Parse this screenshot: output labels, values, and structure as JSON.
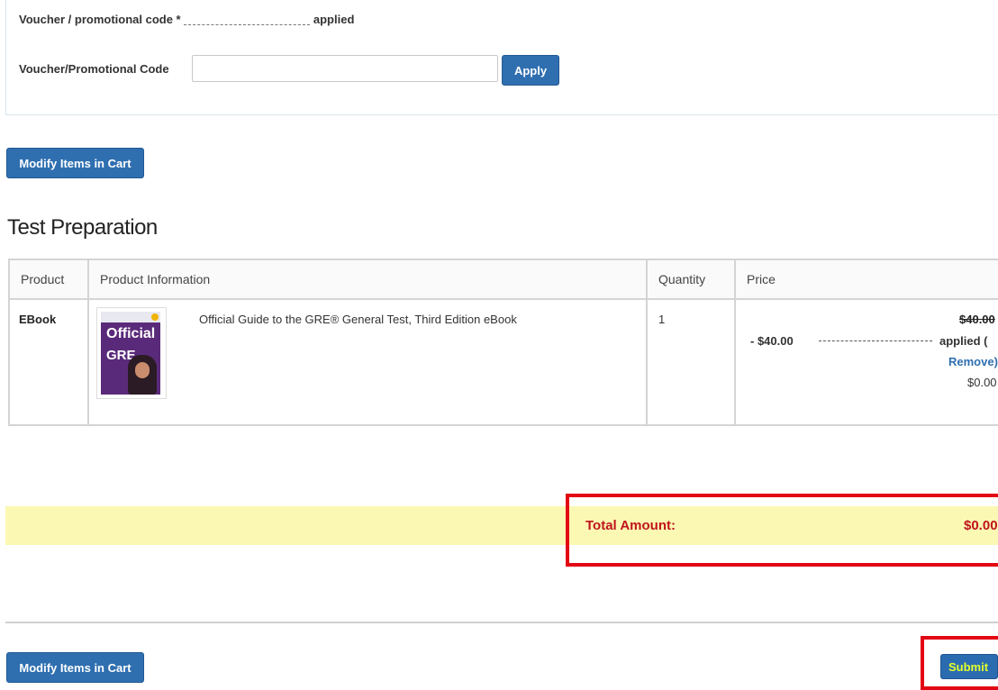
{
  "voucher": {
    "applied_prefix": "Voucher / promotional code *",
    "applied_code": "",
    "applied_suffix": "applied",
    "field_label": "Voucher/Promotional Code",
    "field_value": "",
    "apply_label": "Apply"
  },
  "modify_label": "Modify Items in Cart",
  "section_title": "Test Preparation",
  "table": {
    "headers": [
      "Product",
      "Product Information",
      "Quantity",
      "Price"
    ],
    "rows": [
      {
        "product": "EBook",
        "info": "Official Guide to the GRE® General Test, Third Edition eBook",
        "quantity": "1",
        "discount": "- $40.00",
        "original_price": "$40.00",
        "applied_text": "applied (",
        "remove_text": "Remove)",
        "final_price": "$0.00"
      }
    ]
  },
  "cover": {
    "line1": "Official",
    "line2": "GRE"
  },
  "total": {
    "label": "Total Amount:",
    "value": "$0.00"
  },
  "submit_label": "Submit",
  "colors": {
    "accent_blue": "#2f6fb0",
    "total_red": "#c0141c",
    "highlight_yellow": "#fbf8b3",
    "annotation_red": "#e30613"
  }
}
